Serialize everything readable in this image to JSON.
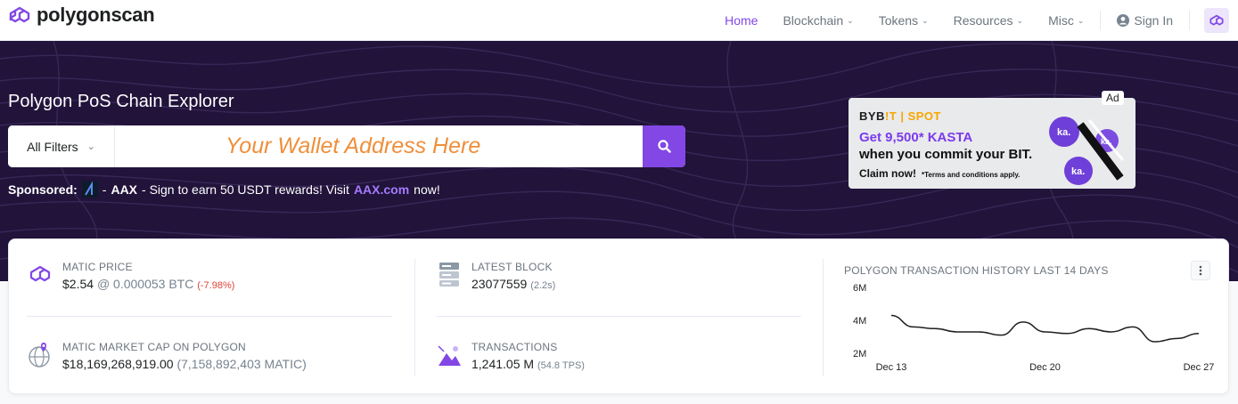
{
  "header": {
    "logo_text": "polygonscan",
    "nav": [
      {
        "label": "Home",
        "active": true
      },
      {
        "label": "Blockchain",
        "dropdown": true
      },
      {
        "label": "Tokens",
        "dropdown": true
      },
      {
        "label": "Resources",
        "dropdown": true
      },
      {
        "label": "Misc",
        "dropdown": true
      }
    ],
    "signin_label": "Sign In"
  },
  "hero": {
    "title": "Polygon PoS Chain Explorer",
    "filter_label": "All Filters",
    "search_placeholder": "Your Wallet Address Here",
    "sponsored": {
      "prefix": "Sponsored:",
      "brand": "AAX",
      "text": "- Sign to earn 50 USDT rewards! Visit",
      "link": "AAX.com",
      "suffix": "now!"
    }
  },
  "ad": {
    "tag": "Ad",
    "brand_a": "BYB",
    "brand_b": "!T | SPOT",
    "line1": "Get 9,500* KASTA",
    "line2": "when you commit your BIT.",
    "cta": "Claim now!",
    "terms": "*Terms and conditions apply."
  },
  "stats": {
    "matic_price": {
      "label": "MATIC PRICE",
      "usd": "$2.54",
      "at": "@",
      "btc": "0.000053 BTC",
      "change": "(-7.98%)"
    },
    "market_cap": {
      "label": "MATIC MARKET CAP ON POLYGON",
      "usd": "$18,169,268,919.00",
      "matic": "(7,158,892,403 MATIC)"
    },
    "latest_block": {
      "label": "LATEST BLOCK",
      "value": "23077559",
      "time": "(2.2s)"
    },
    "transactions": {
      "label": "TRANSACTIONS",
      "value": "1,241.05 M",
      "tps": "(54.8 TPS)"
    }
  },
  "chart_data": {
    "type": "line",
    "title": "POLYGON TRANSACTION HISTORY LAST 14 DAYS",
    "x": [
      "Dec 13",
      "Dec 14",
      "Dec 15",
      "Dec 16",
      "Dec 17",
      "Dec 18",
      "Dec 19",
      "Dec 20",
      "Dec 21",
      "Dec 22",
      "Dec 23",
      "Dec 24",
      "Dec 25",
      "Dec 26",
      "Dec 27"
    ],
    "xticks": [
      "Dec 13",
      "Dec 20",
      "Dec 27"
    ],
    "yticks": [
      "6M",
      "4M",
      "2M"
    ],
    "ylim": [
      2000000,
      6000000
    ],
    "series": [
      {
        "values": [
          4300000,
          3600000,
          3500000,
          3300000,
          3300000,
          3100000,
          3900000,
          3300000,
          3200000,
          3500000,
          3300000,
          3600000,
          2700000,
          2900000,
          3200000
        ]
      }
    ],
    "color": "#1e2022"
  }
}
